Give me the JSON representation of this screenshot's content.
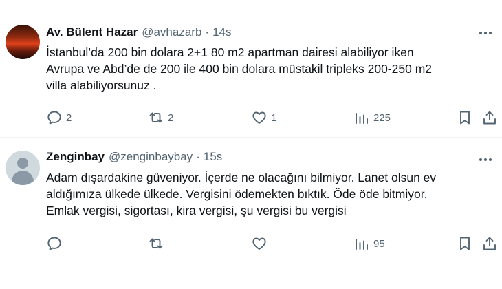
{
  "tweets": [
    {
      "name": "Av. Bülent Hazar",
      "handle": "@avhazarb",
      "separator": "·",
      "time": "14s",
      "avatar": "sunset-avatar",
      "text_lines": [
        "İstanbul’da 200 bin dolara 2+1 80 m2 apartman dairesi alabiliyor iken",
        "Avrupa ve Abd’de de 200 ile 400 bin dolara müstakil tripleks 200-250 m2",
        "villa alabiliyorsunuz ."
      ],
      "replies": "2",
      "reposts": "2",
      "likes": "1",
      "views": "225"
    },
    {
      "name": "Zenginbay",
      "handle": "@zenginbaybay",
      "separator": "·",
      "time": "15s",
      "avatar": "default-avatar",
      "text_lines": [
        "Adam dışardakine güveniyor. İçerde ne olacağını bilmiyor. Lanet olsun ev",
        "aldığımıza ülkede ülkede. Vergisini ödemekten bıktık. Öde öde bitmiyor.",
        "Emlak vergisi, sigortası, kira vergisi, şu vergisi bu vergisi"
      ],
      "replies": "",
      "reposts": "",
      "likes": "",
      "views": "95"
    }
  ],
  "icons": {
    "reply": "reply-icon",
    "repost": "repost-icon",
    "like": "like-icon",
    "views": "views-icon",
    "bookmark": "bookmark-icon",
    "share": "share-icon",
    "more": "more-icon"
  },
  "colors": {
    "text_primary": "#0f1419",
    "text_secondary": "#536471",
    "divider": "#eff3f4"
  }
}
